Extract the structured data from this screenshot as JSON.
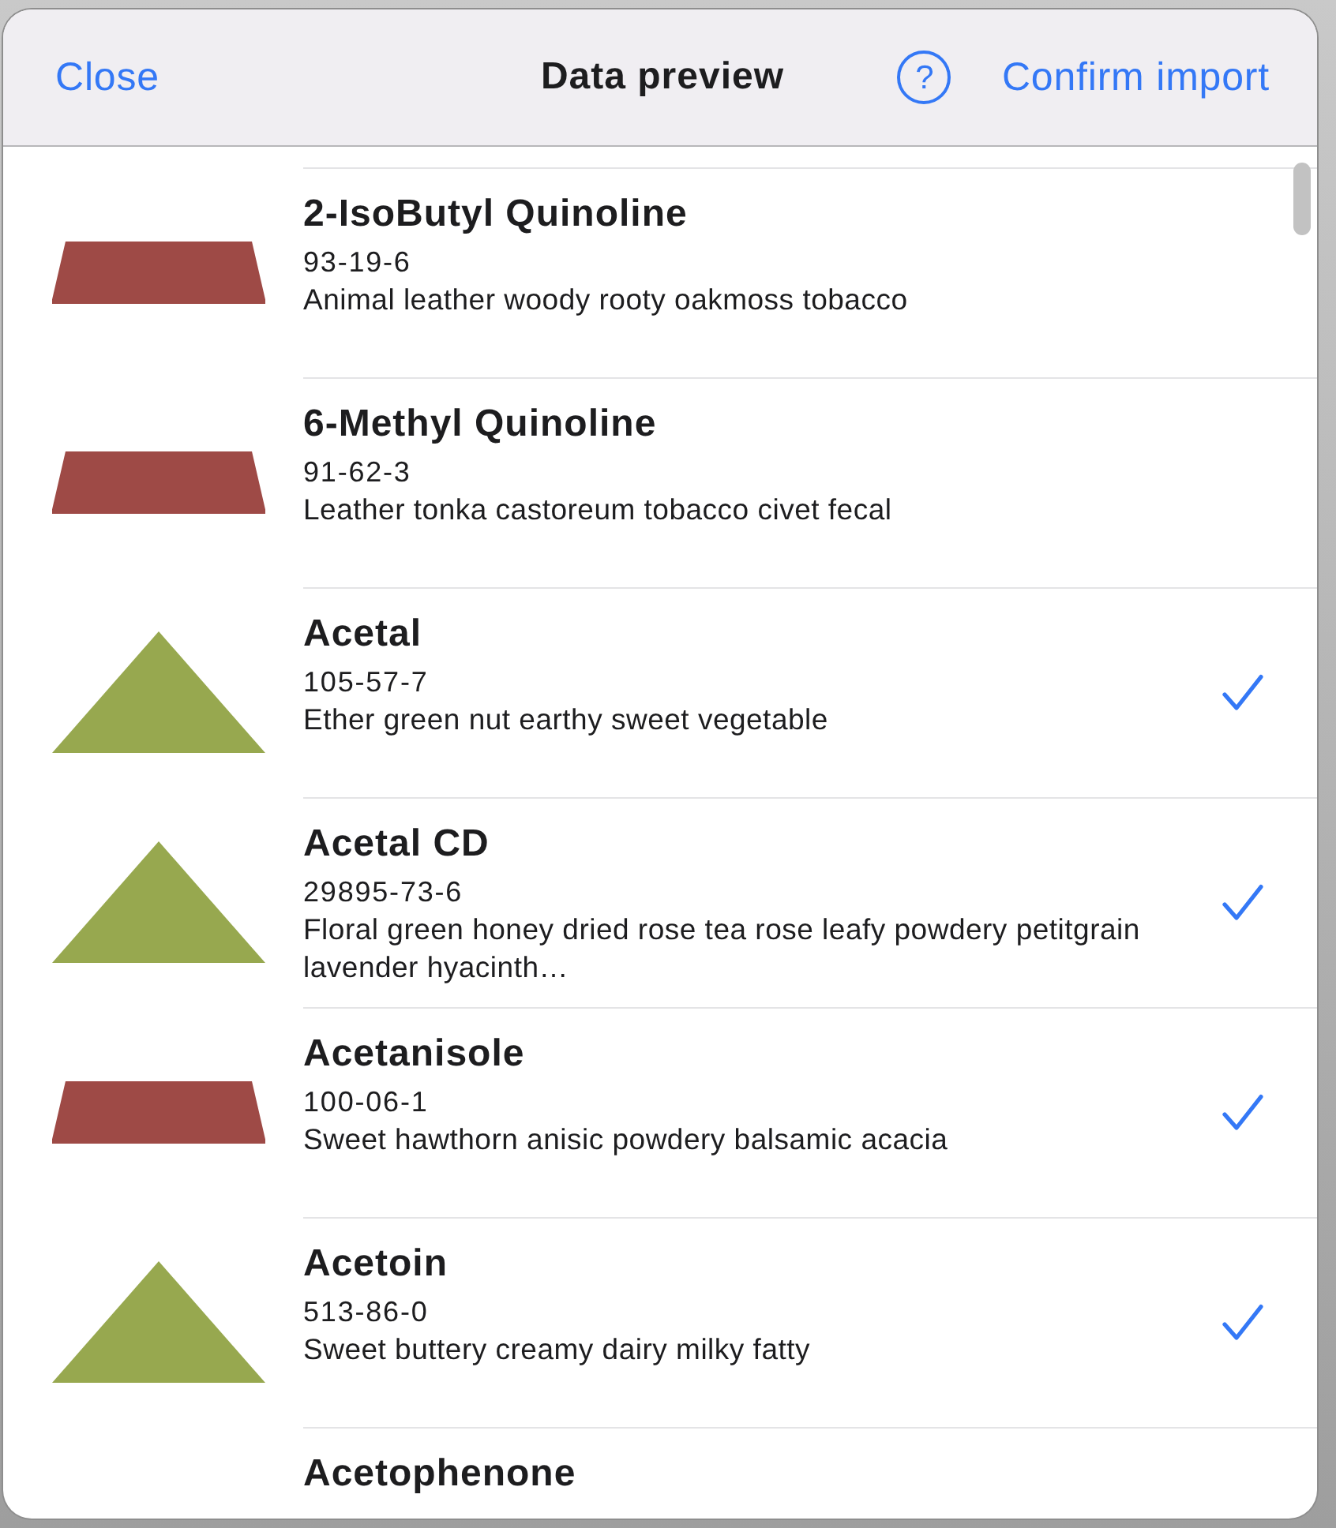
{
  "header": {
    "close_label": "Close",
    "title": "Data preview",
    "help_label": "?",
    "confirm_label": "Confirm import"
  },
  "items": [
    {
      "name": "2-IsoButyl Quinoline",
      "cas": "93-19-6",
      "description": "Animal leather woody rooty oakmoss tobacco",
      "kind": "trapezoid",
      "color": "#9e4a46",
      "checked": false
    },
    {
      "name": "6-Methyl Quinoline",
      "cas": "91-62-3",
      "description": "Leather tonka castoreum tobacco civet fecal",
      "kind": "trapezoid",
      "color": "#9e4a46",
      "checked": false
    },
    {
      "name": "Acetal",
      "cas": "105-57-7",
      "description": "Ether green nut earthy sweet vegetable",
      "kind": "triangle",
      "color": "#97a84f",
      "checked": true
    },
    {
      "name": "Acetal CD",
      "cas": "29895-73-6",
      "description": "Floral green honey dried rose tea rose leafy powdery petitgrain lavender hyacinth…",
      "kind": "triangle",
      "color": "#97a84f",
      "checked": true
    },
    {
      "name": "Acetanisole",
      "cas": "100-06-1",
      "description": "Sweet hawthorn anisic powdery balsamic acacia",
      "kind": "trapezoid",
      "color": "#9e4a46",
      "checked": true
    },
    {
      "name": "Acetoin",
      "cas": "513-86-0",
      "description": "Sweet buttery creamy dairy milky fatty",
      "kind": "triangle",
      "color": "#97a84f",
      "checked": true
    },
    {
      "name": "Acetophenone"
    }
  ]
}
